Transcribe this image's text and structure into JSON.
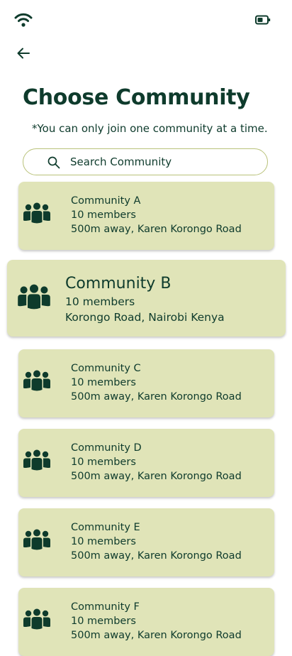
{
  "icons": {
    "wifi": "wifi-icon",
    "battery": "battery-icon",
    "back": "arrow-left-icon",
    "search": "search-icon",
    "community": "people-group-icon"
  },
  "colors": {
    "primary": "#0e3b2c",
    "card_bg": "#e0e4b8",
    "search_border": "#b9c27a"
  },
  "header": {
    "title": "Choose Community",
    "subtitle": "*You can only join one community at a time."
  },
  "search": {
    "placeholder": "Search Community",
    "value": ""
  },
  "communities": [
    {
      "name": "Community A",
      "members": "10 members",
      "location": "500m away, Karen Korongo Road",
      "selected": false
    },
    {
      "name": "Community B",
      "members": "10 members",
      "location": "Korongo Road, Nairobi Kenya",
      "selected": true
    },
    {
      "name": "Community C",
      "members": "10 members",
      "location": "500m away, Karen Korongo Road",
      "selected": false
    },
    {
      "name": "Community D",
      "members": "10 members",
      "location": "500m away, Karen Korongo Road",
      "selected": false
    },
    {
      "name": "Community E",
      "members": "10 members",
      "location": "500m away, Karen Korongo Road",
      "selected": false
    },
    {
      "name": "Community F",
      "members": "10 members",
      "location": "500m away, Karen Korongo Road",
      "selected": false
    }
  ]
}
